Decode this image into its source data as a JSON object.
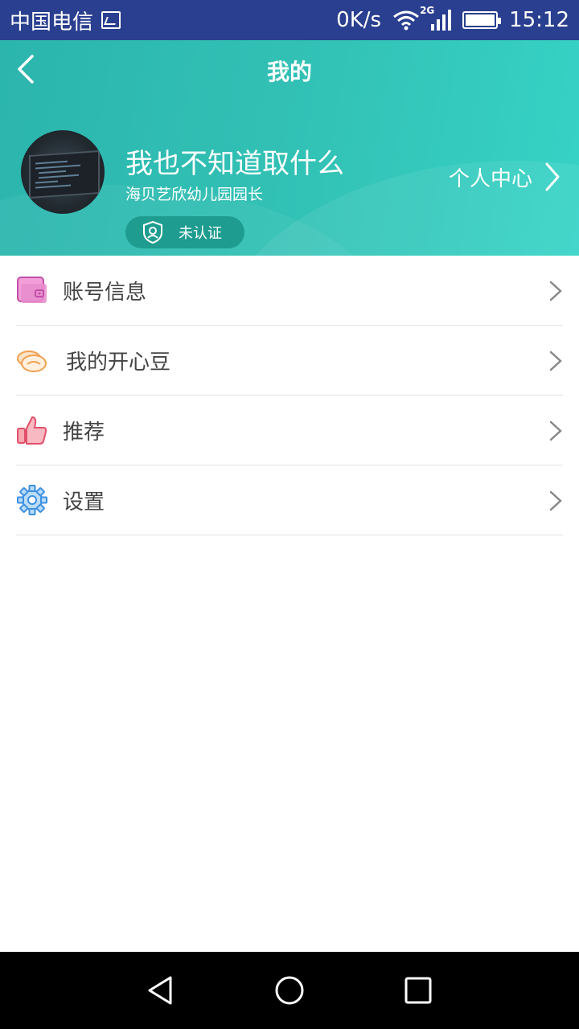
{
  "status_bar": {
    "carrier": "中国电信",
    "net_speed": "0K/s",
    "network_type": "2G",
    "time": "15:12"
  },
  "header": {
    "title": "我的",
    "user_name": "我也不知道取什么",
    "user_role": "海贝艺欣幼儿园园长",
    "cert_status": "未认证",
    "personal_center_label": "个人中心"
  },
  "menu": {
    "items": [
      {
        "label": "账号信息",
        "icon": "wallet-icon"
      },
      {
        "label": "我的开心豆",
        "icon": "beans-icon"
      },
      {
        "label": "推荐",
        "icon": "thumbs-up-icon"
      },
      {
        "label": "设置",
        "icon": "gear-icon"
      }
    ]
  },
  "colors": {
    "status_bar": "#2a3f8f",
    "header_start": "#2bb5ad",
    "header_end": "#36d3c6",
    "badge": "#1e9c8f",
    "nav_bar": "#000000"
  }
}
